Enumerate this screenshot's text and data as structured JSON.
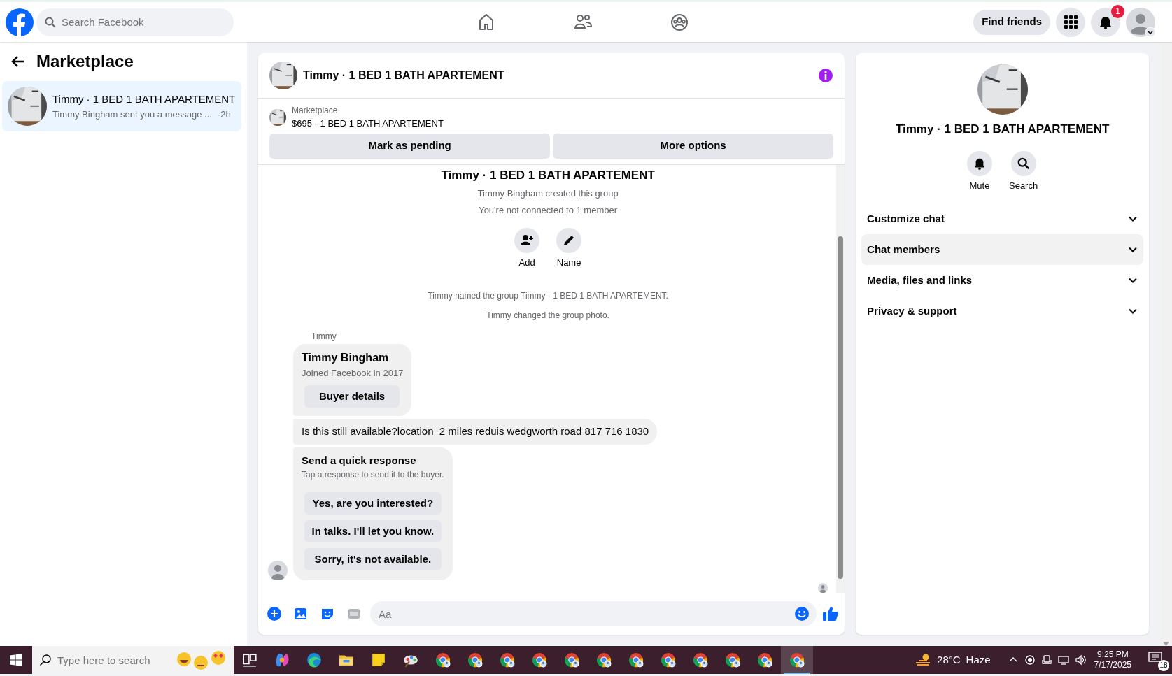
{
  "topbar": {
    "search": {
      "placeholder": "Search Facebook"
    },
    "nav": [
      {
        "kind": "home"
      },
      {
        "kind": "friends"
      },
      {
        "kind": "groups"
      }
    ],
    "find_friends": "Find friends",
    "notifications_count": "1"
  },
  "sidebar": {
    "title": "Marketplace",
    "conversations": [
      {
        "title": "Timmy · 1 BED 1 BATH APARTEMENT",
        "preview": "Timmy Bingham sent you a message ...",
        "time": "·2h",
        "selected": true
      }
    ]
  },
  "chat": {
    "title": "Timmy · 1 BED 1 BATH APARTEMENT",
    "listing": {
      "label": "Marketplace",
      "item": "$695 - 1 BED 1 BATH APARTEMENT"
    },
    "actions": [
      "Mark as pending",
      "More options"
    ],
    "intro": {
      "title": "Timmy · 1 BED 1 BATH APARTEMENT",
      "lines": [
        "Timmy Bingham created this group",
        "You're not connected to 1 member"
      ],
      "buttons": [
        {
          "kind": "add",
          "label": "Add"
        },
        {
          "kind": "name",
          "label": "Name"
        }
      ]
    },
    "events": [
      "Timmy named the group Timmy · 1 BED 1 BATH APARTEMENT.",
      "Timmy changed the group photo."
    ],
    "sender": "Timmy",
    "profile_card": {
      "name": "Timmy Bingham",
      "subtitle": "Joined Facebook in 2017",
      "button": "Buyer details"
    },
    "message": "Is this still available?location  2 miles reduis wedgworth road 817 716 1830",
    "quick_response": {
      "title": "Send a quick response",
      "subtitle": "Tap a response to send it to the buyer.",
      "options": [
        "Yes, are you interested?",
        "In talks. I'll let you know.",
        "Sorry, it's not available."
      ]
    },
    "composer": {
      "placeholder": "Aa"
    }
  },
  "details": {
    "title": "Timmy · 1 BED 1 BATH APARTEMENT",
    "actions": [
      {
        "kind": "mute",
        "label": "Mute"
      },
      {
        "kind": "search",
        "label": "Search"
      }
    ],
    "sections": [
      {
        "label": "Customize chat",
        "hovered": false
      },
      {
        "label": "Chat members",
        "hovered": true
      },
      {
        "label": "Media, files and links",
        "hovered": false
      },
      {
        "label": "Privacy & support",
        "hovered": false
      }
    ]
  },
  "taskbar": {
    "search": {
      "placeholder": "Type here to search"
    },
    "apps": [
      {
        "kind": "taskview",
        "selected": false
      },
      {
        "kind": "copilot",
        "selected": false
      },
      {
        "kind": "edge",
        "selected": false
      },
      {
        "kind": "explorer",
        "selected": false
      },
      {
        "kind": "sticky",
        "selected": false
      },
      {
        "kind": "paint",
        "selected": false
      },
      {
        "kind": "chrome",
        "selected": false
      },
      {
        "kind": "chrome",
        "selected": false
      },
      {
        "kind": "chrome",
        "selected": false
      },
      {
        "kind": "chrome",
        "selected": false
      },
      {
        "kind": "chrome",
        "selected": false
      },
      {
        "kind": "chrome",
        "selected": false
      },
      {
        "kind": "chrome",
        "selected": false
      },
      {
        "kind": "chrome",
        "selected": false
      },
      {
        "kind": "chrome",
        "selected": false
      },
      {
        "kind": "chrome",
        "selected": false
      },
      {
        "kind": "chrome",
        "selected": false
      },
      {
        "kind": "chrome",
        "selected": true
      }
    ],
    "weather": {
      "temperature": "28°C",
      "condition": "Haze"
    },
    "time": "9:25 PM",
    "date": "7/17/2025",
    "notifications": "18"
  }
}
